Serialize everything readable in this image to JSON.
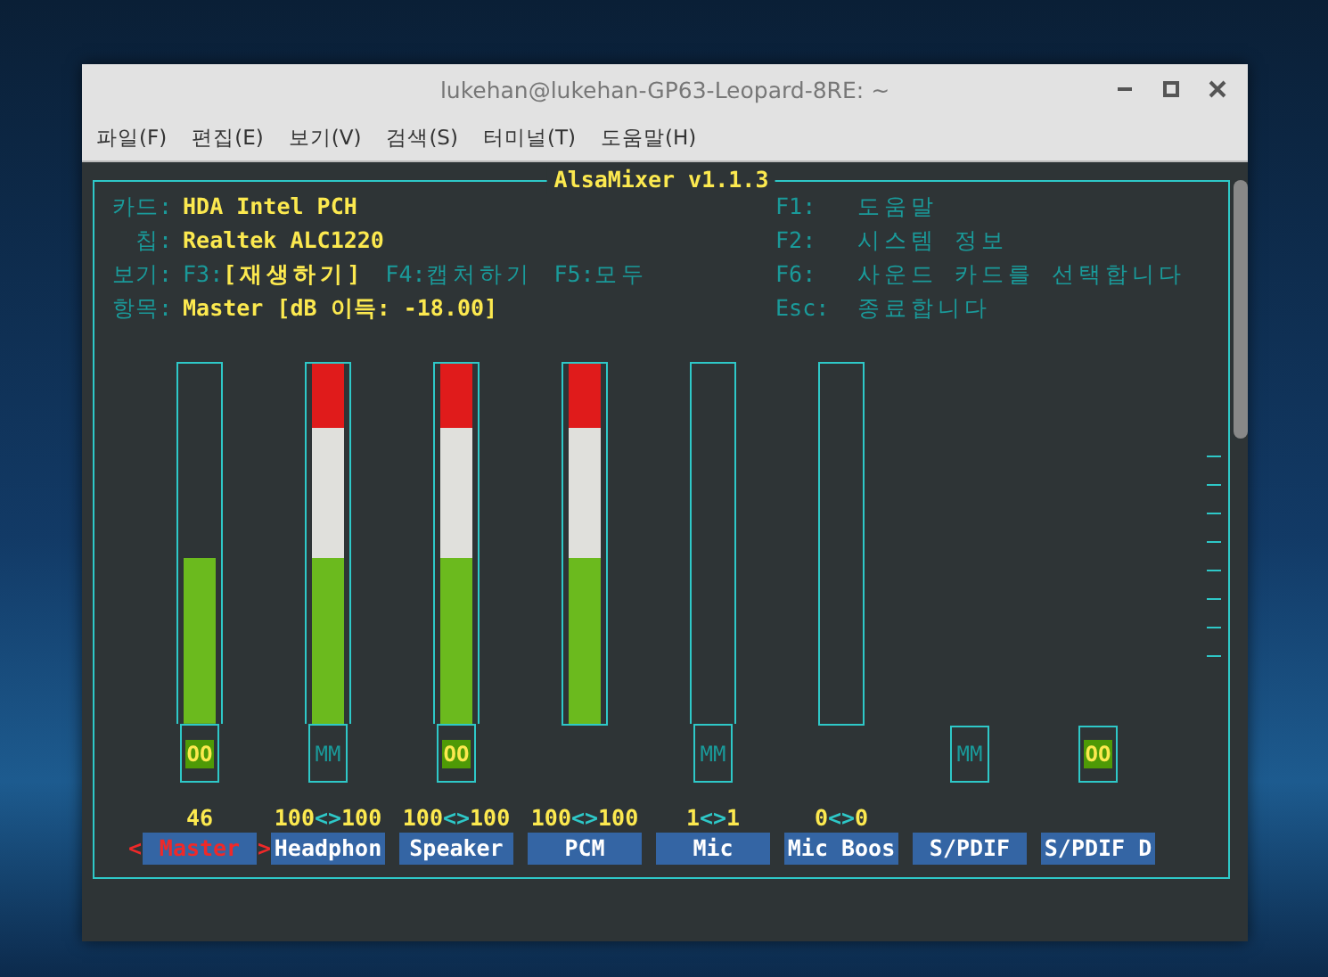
{
  "window": {
    "title": "lukehan@lukehan-GP63-Leopard-8RE: ~"
  },
  "menu": [
    "파일(F)",
    "편집(E)",
    "보기(V)",
    "검색(S)",
    "터미널(T)",
    "도움말(H)"
  ],
  "mixer": {
    "title": "AlsaMixer v1.1.3",
    "info": [
      {
        "kind": "value",
        "label": "카드:",
        "value": "HDA Intel PCH"
      },
      {
        "kind": "value",
        "label": "칩:",
        "value": "Realtek ALC1220"
      },
      {
        "kind": "options",
        "label": "보기:",
        "options": [
          {
            "key": "F3:",
            "text": "[재생하기]",
            "selected": true
          },
          {
            "key": "F4:",
            "text": "캡처하기",
            "selected": false
          },
          {
            "key": "F5:",
            "text": "모두",
            "selected": false
          }
        ]
      },
      {
        "kind": "value",
        "label": "항목:",
        "value": "Master [dB 이득: -18.00]"
      }
    ],
    "keys": [
      {
        "key": "F1:",
        "text": "도움말"
      },
      {
        "key": "F2:",
        "text": "시스템 정보"
      },
      {
        "key": "F6:",
        "text": "사운드 카드를 선택합니다"
      },
      {
        "key": "Esc:",
        "text": "종료합니다"
      }
    ],
    "selection_marks": [
      "<",
      ">"
    ],
    "channels": [
      {
        "name": "Master",
        "selected": true,
        "meter": true,
        "level": 0.46,
        "value": [
          "46"
        ],
        "switch": {
          "text": "OO",
          "on": true
        }
      },
      {
        "name": "Headphon",
        "selected": false,
        "meter": true,
        "level": 1,
        "value": [
          "100",
          "<>",
          "100"
        ],
        "switch": {
          "text": "MM",
          "on": false
        }
      },
      {
        "name": "Speaker",
        "selected": false,
        "meter": true,
        "level": 1,
        "value": [
          "100",
          "<>",
          "100"
        ],
        "switch": {
          "text": "OO",
          "on": true
        }
      },
      {
        "name": "PCM",
        "selected": false,
        "meter": true,
        "level": 1,
        "value": [
          "100",
          "<>",
          "100"
        ]
      },
      {
        "name": "Mic",
        "selected": false,
        "meter": true,
        "value": [
          "1",
          "<>",
          "1"
        ],
        "switch": {
          "text": "MM",
          "on": false
        }
      },
      {
        "name": "Mic Boos",
        "selected": false,
        "meter": true,
        "value": [
          "0",
          "<>",
          "0"
        ]
      },
      {
        "name": "S/PDIF",
        "selected": false,
        "switch": {
          "text": "MM",
          "on": false
        }
      },
      {
        "name": "S/PDIF D",
        "selected": false,
        "switch": {
          "text": "OO",
          "on": true
        }
      }
    ]
  }
}
